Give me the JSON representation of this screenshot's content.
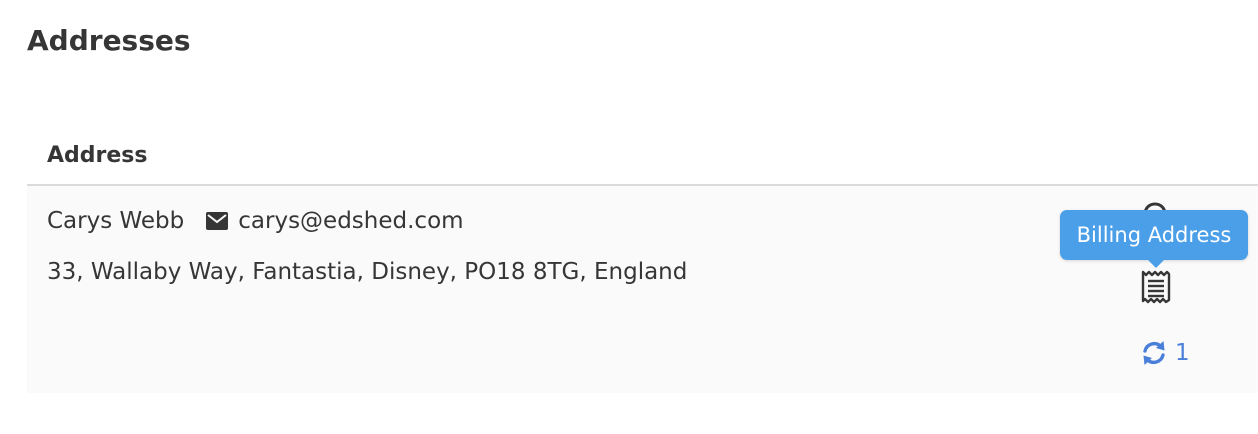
{
  "page": {
    "title": "Addresses"
  },
  "table": {
    "columns": [
      "Address"
    ],
    "rows": [
      {
        "name": "Carys Webb",
        "email": "carys@edshed.com",
        "address": "33, Wallaby Way, Fantastia, Disney, PO18 8TG, England",
        "sync_count": "1"
      }
    ]
  },
  "tooltip": {
    "text": "Billing Address"
  },
  "icons": {
    "email": "envelope-icon",
    "billing": "receipt-icon",
    "sync": "sync-icon",
    "shipping": "location-pin-icon"
  },
  "colors": {
    "accent": "#4a7fd9",
    "tooltip_bg": "#4a9fe8",
    "row_bg": "#fafafa",
    "text": "#363636"
  }
}
